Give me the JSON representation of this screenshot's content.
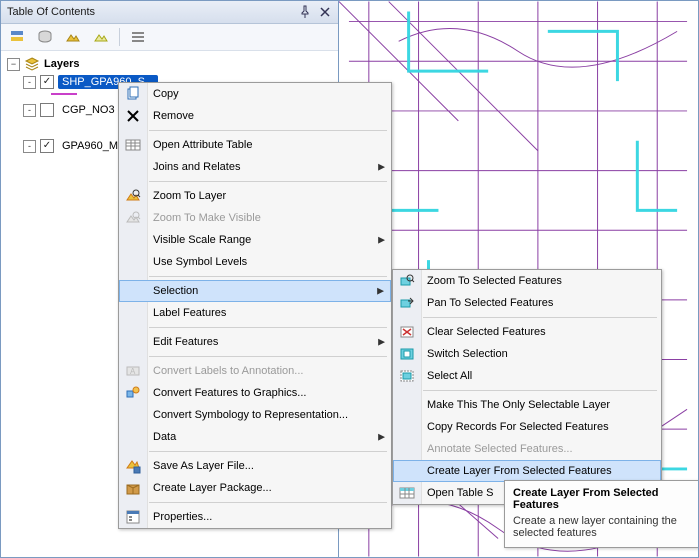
{
  "toc": {
    "title": "Table Of Contents",
    "root_label": "Layers",
    "layers": [
      {
        "name": "SHP_GPA960_S...",
        "checked": true,
        "selected": true,
        "expand": "-"
      },
      {
        "name": "CGP_NO3",
        "checked": false,
        "selected": false,
        "expand": "-"
      },
      {
        "name": "GPA960_M",
        "checked": true,
        "selected": false,
        "expand": "-"
      }
    ]
  },
  "ctx_menu": {
    "items": [
      {
        "icon": "copy-icon",
        "label": "Copy"
      },
      {
        "icon": "remove-icon",
        "label": "Remove"
      },
      {
        "sep": true
      },
      {
        "icon": "table-icon",
        "label": "Open Attribute Table"
      },
      {
        "icon": null,
        "label": "Joins and Relates",
        "sub": true
      },
      {
        "sep": true
      },
      {
        "icon": "zoom-layer-icon",
        "label": "Zoom To Layer"
      },
      {
        "icon": "zoom-visible-icon",
        "label": "Zoom To Make Visible",
        "disabled": true
      },
      {
        "icon": null,
        "label": "Visible Scale Range",
        "sub": true
      },
      {
        "icon": null,
        "label": "Use Symbol Levels"
      },
      {
        "sep": true
      },
      {
        "icon": null,
        "label": "Selection",
        "sub": true,
        "hover": true
      },
      {
        "icon": null,
        "label": "Label Features"
      },
      {
        "sep": true
      },
      {
        "icon": null,
        "label": "Edit Features",
        "sub": true
      },
      {
        "sep": true
      },
      {
        "icon": "convert-labels-icon",
        "label": "Convert Labels to Annotation...",
        "disabled": true
      },
      {
        "icon": "convert-graphics-icon",
        "label": "Convert Features to Graphics..."
      },
      {
        "icon": null,
        "label": "Convert Symbology to Representation..."
      },
      {
        "icon": null,
        "label": "Data",
        "sub": true
      },
      {
        "sep": true
      },
      {
        "icon": "save-layer-icon",
        "label": "Save As Layer File..."
      },
      {
        "icon": "layer-package-icon",
        "label": "Create Layer Package..."
      },
      {
        "sep": true
      },
      {
        "icon": "properties-icon",
        "label": "Properties..."
      }
    ]
  },
  "sel_submenu": {
    "items": [
      {
        "icon": "zoom-sel-icon",
        "label": "Zoom To Selected Features"
      },
      {
        "icon": "pan-sel-icon",
        "label": "Pan To Selected Features"
      },
      {
        "sep": true
      },
      {
        "icon": "clear-sel-icon",
        "label": "Clear Selected Features"
      },
      {
        "icon": "switch-sel-icon",
        "label": "Switch Selection"
      },
      {
        "icon": "select-all-icon",
        "label": "Select All"
      },
      {
        "sep": true
      },
      {
        "icon": null,
        "label": "Make This The Only Selectable Layer"
      },
      {
        "icon": null,
        "label": "Copy Records For Selected Features"
      },
      {
        "icon": null,
        "label": "Annotate Selected Features...",
        "disabled": true
      },
      {
        "icon": null,
        "label": "Create Layer From Selected Features",
        "hover": true
      },
      {
        "icon": "open-table-icon",
        "label": "Open Table S"
      }
    ]
  },
  "tooltip": {
    "title": "Create Layer From Selected Features",
    "body": "Create a new layer containing the selected features"
  }
}
